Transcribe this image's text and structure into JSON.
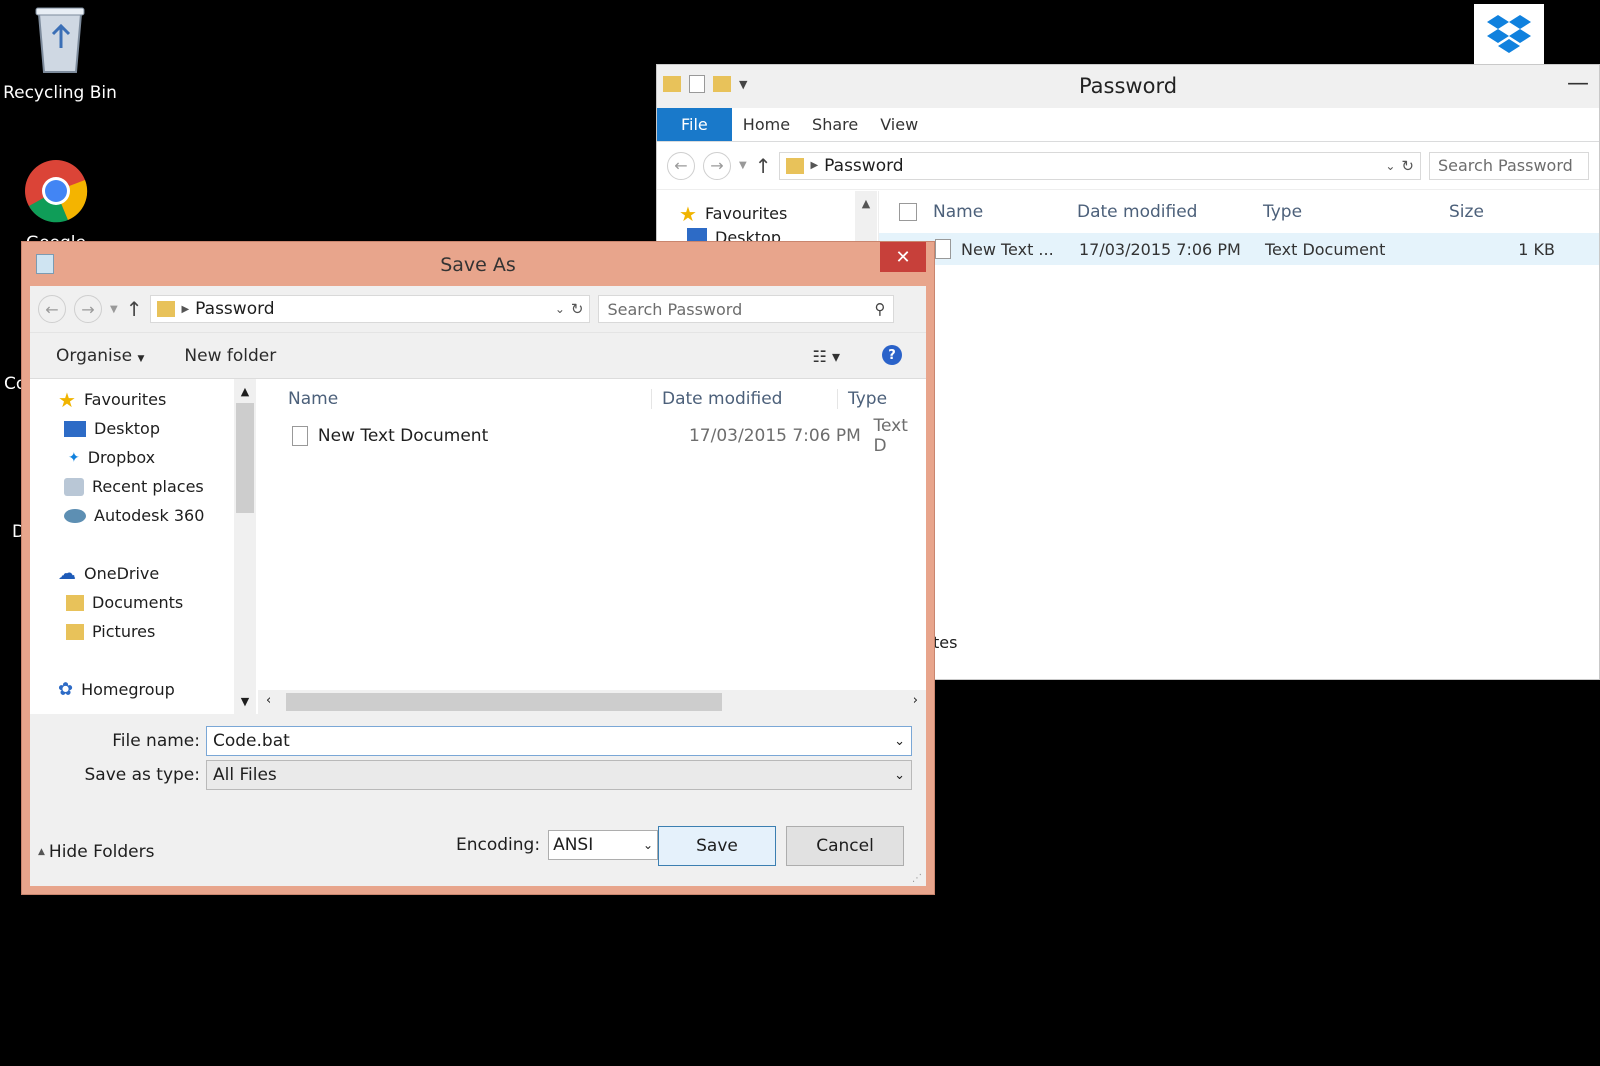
{
  "desktop": {
    "recycle_bin_label": "Recycling Bin",
    "chrome_label": "Google",
    "clip_c": "Co",
    "clip_d": "D"
  },
  "explorer": {
    "title": "Password",
    "ribbon_tabs": [
      "File",
      "Home",
      "Share",
      "View"
    ],
    "path": "Password",
    "search_placeholder": "Search Password",
    "nav_items": [
      "Favourites",
      "Desktop"
    ],
    "columns": [
      "Name",
      "Date modified",
      "Type",
      "Size"
    ],
    "file": {
      "name": "New Text ...",
      "date": "17/03/2015 7:06 PM",
      "type": "Text Document",
      "size": "1 KB"
    },
    "status_clip": "tes"
  },
  "saveas": {
    "title": "Save As",
    "close_glyph": "✕",
    "path": "Password",
    "search_placeholder": "Search Password",
    "organise_label": "Organise",
    "new_folder_label": "New folder",
    "nav_items": [
      "Favourites",
      "Desktop",
      "Dropbox",
      "Recent places",
      "Autodesk 360",
      "OneDrive",
      "Documents",
      "Pictures",
      "Homegroup"
    ],
    "columns": [
      "Name",
      "Date modified",
      "Type"
    ],
    "file": {
      "name": "New Text Document",
      "date": "17/03/2015 7:06 PM",
      "type": "Text D"
    },
    "file_name_label": "File name:",
    "file_name_value": "Code.bat",
    "save_type_label": "Save as type:",
    "save_type_value": "All Files",
    "hide_folders_label": "Hide Folders",
    "encoding_label": "Encoding:",
    "encoding_value": "ANSI",
    "save_label": "Save",
    "cancel_label": "Cancel"
  },
  "colors": {
    "accent": "#1979ca",
    "dialog_frame": "#e8a58c",
    "close_red": "#c7403a"
  }
}
